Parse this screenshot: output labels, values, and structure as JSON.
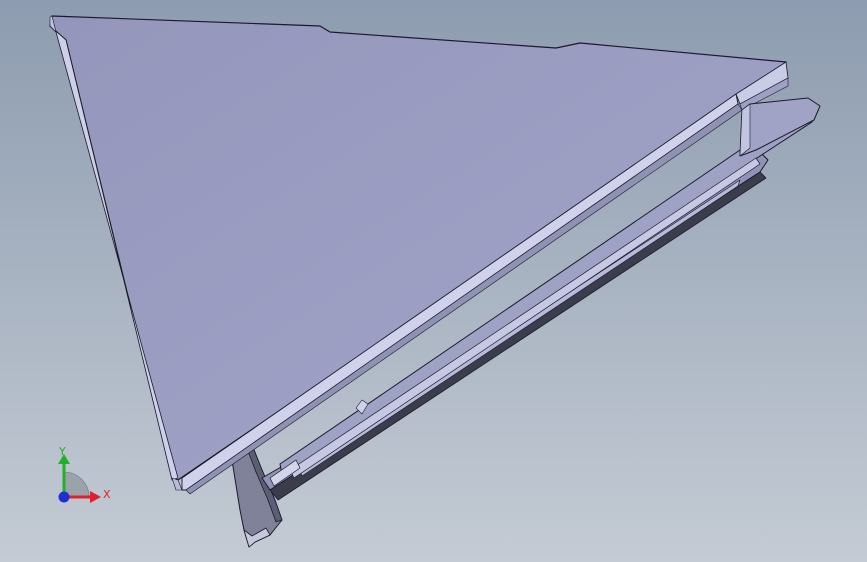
{
  "viewport": {
    "background_top": "#8d9cb0",
    "background_bottom": "#c4cbd4"
  },
  "model": {
    "face_color": "#9a9cc0",
    "edge_color": "#1a1a2a",
    "highlight_color": "#c9cbe6",
    "shadow_color": "#4a4e66"
  },
  "triad": {
    "x_label": "X",
    "y_label": "Y",
    "x_color": "#e0202a",
    "y_color": "#22b02a",
    "z_color": "#2030d0"
  }
}
